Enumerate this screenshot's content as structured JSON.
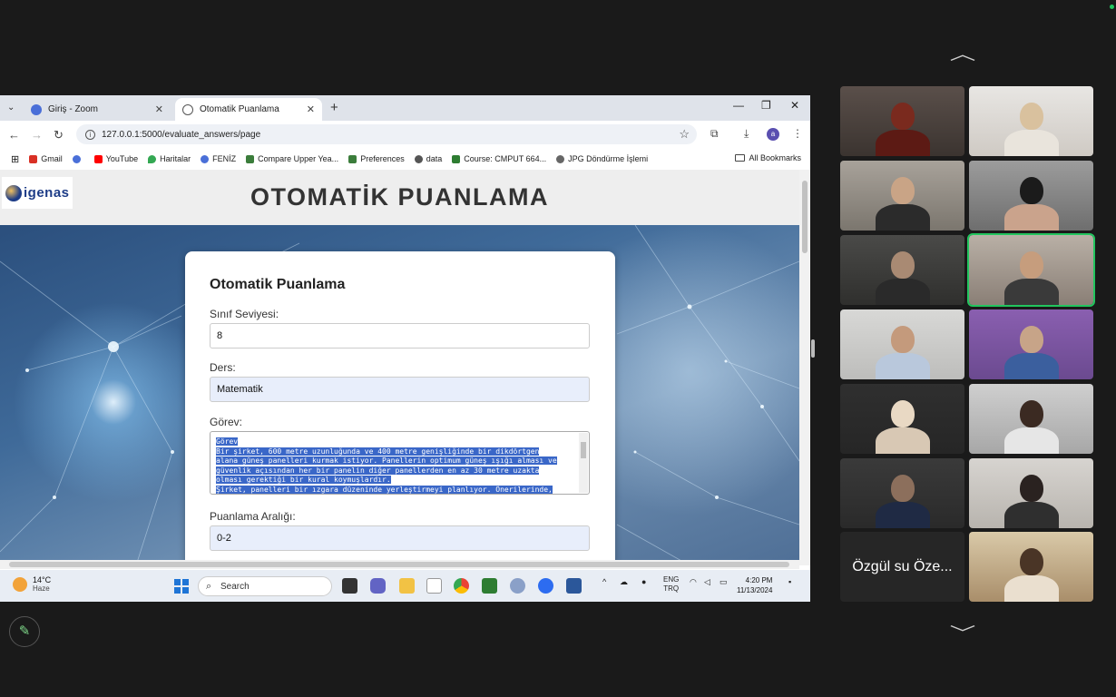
{
  "browser": {
    "tabs": [
      {
        "label": "Giriş - Zoom",
        "active": false,
        "icon_color": "#4a6fd8"
      },
      {
        "label": "Otomatik Puanlama",
        "active": true,
        "icon_color": "#555555"
      }
    ],
    "url": "127.0.0.1:5000/evaluate_answers/page",
    "bookmarks": [
      {
        "label": "Gmail",
        "icon_color": "#d93025"
      },
      {
        "label": "",
        "icon_color": "#4a6fd8"
      },
      {
        "label": "YouTube",
        "icon_color": "#ff0000"
      },
      {
        "label": "Haritalar",
        "icon_color": "#34a853"
      },
      {
        "label": "FENİZ",
        "icon_color": "#4a6fd8"
      },
      {
        "label": "Compare Upper Yea...",
        "icon_color": "#3b7d3b"
      },
      {
        "label": "Preferences",
        "icon_color": "#3b7d3b"
      },
      {
        "label": "data",
        "icon_color": "#555555"
      },
      {
        "label": "Course: CMPUT 664...",
        "icon_color": "#2e7d32"
      },
      {
        "label": "JPG Döndürme İşlemi",
        "icon_color": "#666666"
      }
    ],
    "all_bookmarks": "All Bookmarks",
    "profile_initial": "a"
  },
  "page": {
    "logo_text": "igenas",
    "header_title": "OTOMATİK PUANLAMA",
    "card_title": "Otomatik Puanlama",
    "grade_label": "Sınıf Seviyesi:",
    "grade_value": "8",
    "subject_label": "Ders:",
    "subject_value": "Matematik",
    "task_label": "Görev:",
    "task_lines": [
      "Görev",
      "Bir şirket, 600 metre uzunluğunda ve 400 metre genişliğinde bir dikdörtgen",
      "alana güneş panelleri kurmak istiyor. Panellerin optimum güneş ışığı alması ve",
      "güvenlik açısından her bir panelin diğer panellerden en az 30 metre uzakta",
      "olması gerektiği bir kural koymuşlardır.",
      "Şirket, panelleri bir ızgara düzeninde yerleştirmeyi planlıyor. Önerilerinde,"
    ],
    "score_label": "Puanlama Aralığı:",
    "score_value": "0-2"
  },
  "taskbar": {
    "temperature": "14°C",
    "weather": "Haze",
    "search_placeholder": "Search",
    "lang_1": "ENG",
    "lang_2": "TRQ",
    "time": "4:20 PM",
    "date": "11/13/2024"
  },
  "gallery": {
    "name_tile": "Özgül su Öze..."
  }
}
